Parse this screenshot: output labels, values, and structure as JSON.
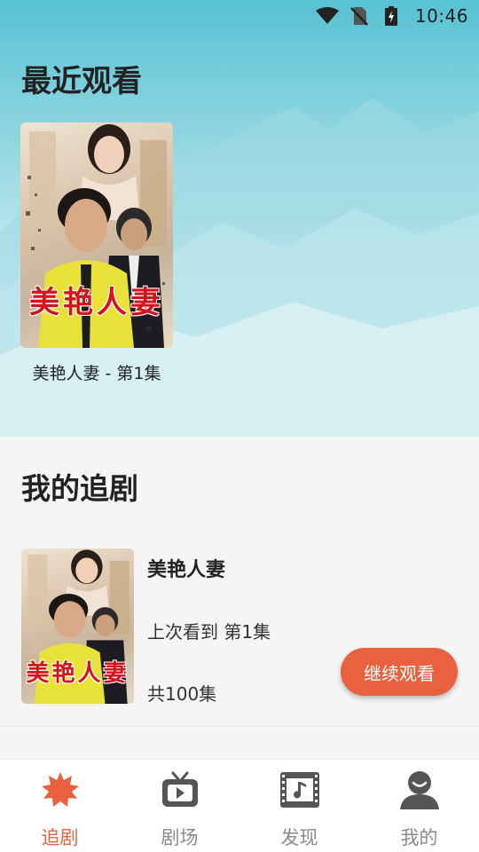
{
  "status_bar": {
    "time": "10:46",
    "icons": [
      "wifi-icon",
      "no-sim-icon",
      "battery-charging-icon"
    ]
  },
  "recent": {
    "title": "最近观看",
    "items": [
      {
        "poster_title": "美艳人妻",
        "caption": "美艳人妻 - 第1集"
      }
    ]
  },
  "my_series": {
    "title": "我的追剧",
    "items": [
      {
        "poster_title": "美艳人妻",
        "name": "美艳人妻",
        "progress": "上次看到 第1集",
        "total": "共100集",
        "continue_label": "继续观看"
      }
    ]
  },
  "bottom_nav": {
    "items": [
      {
        "label": "追剧",
        "icon": "star-burst-icon",
        "active": true
      },
      {
        "label": "剧场",
        "icon": "tv-icon",
        "active": false
      },
      {
        "label": "发现",
        "icon": "film-music-icon",
        "active": false
      },
      {
        "label": "我的",
        "icon": "user-icon",
        "active": false
      }
    ]
  },
  "colors": {
    "accent": "#e8623f",
    "inactive": "#8a8a8a",
    "text": "#222222"
  }
}
